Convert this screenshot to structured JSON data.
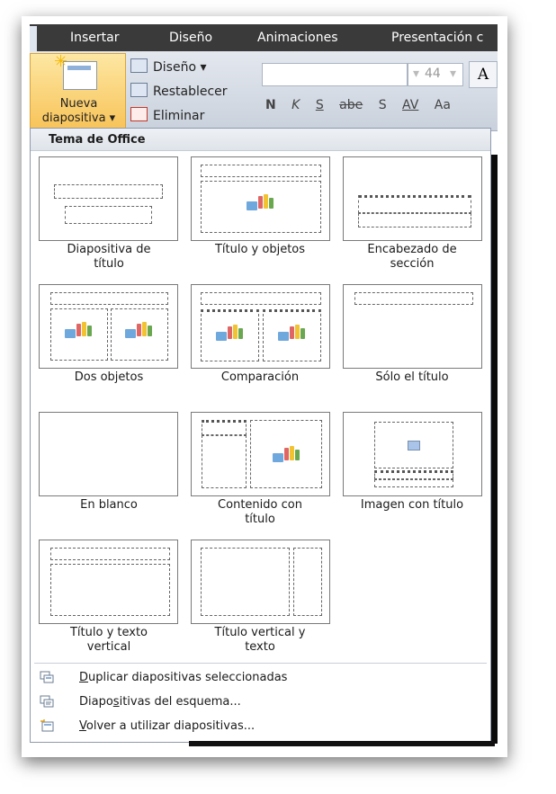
{
  "ribbon": {
    "tabs": [
      "Insertar",
      "Diseño",
      "Animaciones",
      "Presentación c"
    ],
    "nueva_line1": "Nueva",
    "nueva_line2": "diapositiva ▾",
    "diseno": "Diseño ▾",
    "restablecer": "Restablecer",
    "eliminar": "Eliminar",
    "font_size": "44",
    "grow_font": "A",
    "format_buttons": [
      "N",
      "K",
      "S",
      "abe",
      "S",
      "AV",
      "Aa"
    ]
  },
  "panel": {
    "title": "Tema de Office",
    "layouts": [
      {
        "line1": "Diapositiva de",
        "line2": "título"
      },
      {
        "line1": "Título y objetos",
        "line2": ""
      },
      {
        "line1": "Encabezado de",
        "line2": "sección"
      },
      {
        "line1": "Dos objetos",
        "line2": ""
      },
      {
        "line1": "Comparación",
        "line2": ""
      },
      {
        "line1": "Sólo el título",
        "line2": ""
      },
      {
        "line1": "En blanco",
        "line2": ""
      },
      {
        "line1": "Contenido con",
        "line2": "título"
      },
      {
        "line1": "Imagen con título",
        "line2": ""
      },
      {
        "line1": "Título y texto",
        "line2": "vertical"
      },
      {
        "line1": "Título vertical y",
        "line2": "texto"
      }
    ],
    "menu": [
      {
        "pre": "",
        "ul": "D",
        "post": "uplicar diapositivas seleccionadas"
      },
      {
        "pre": "Diapo",
        "ul": "s",
        "post": "itivas del esquema..."
      },
      {
        "pre": "",
        "ul": "V",
        "post": "olver a utilizar diapositivas..."
      }
    ]
  }
}
